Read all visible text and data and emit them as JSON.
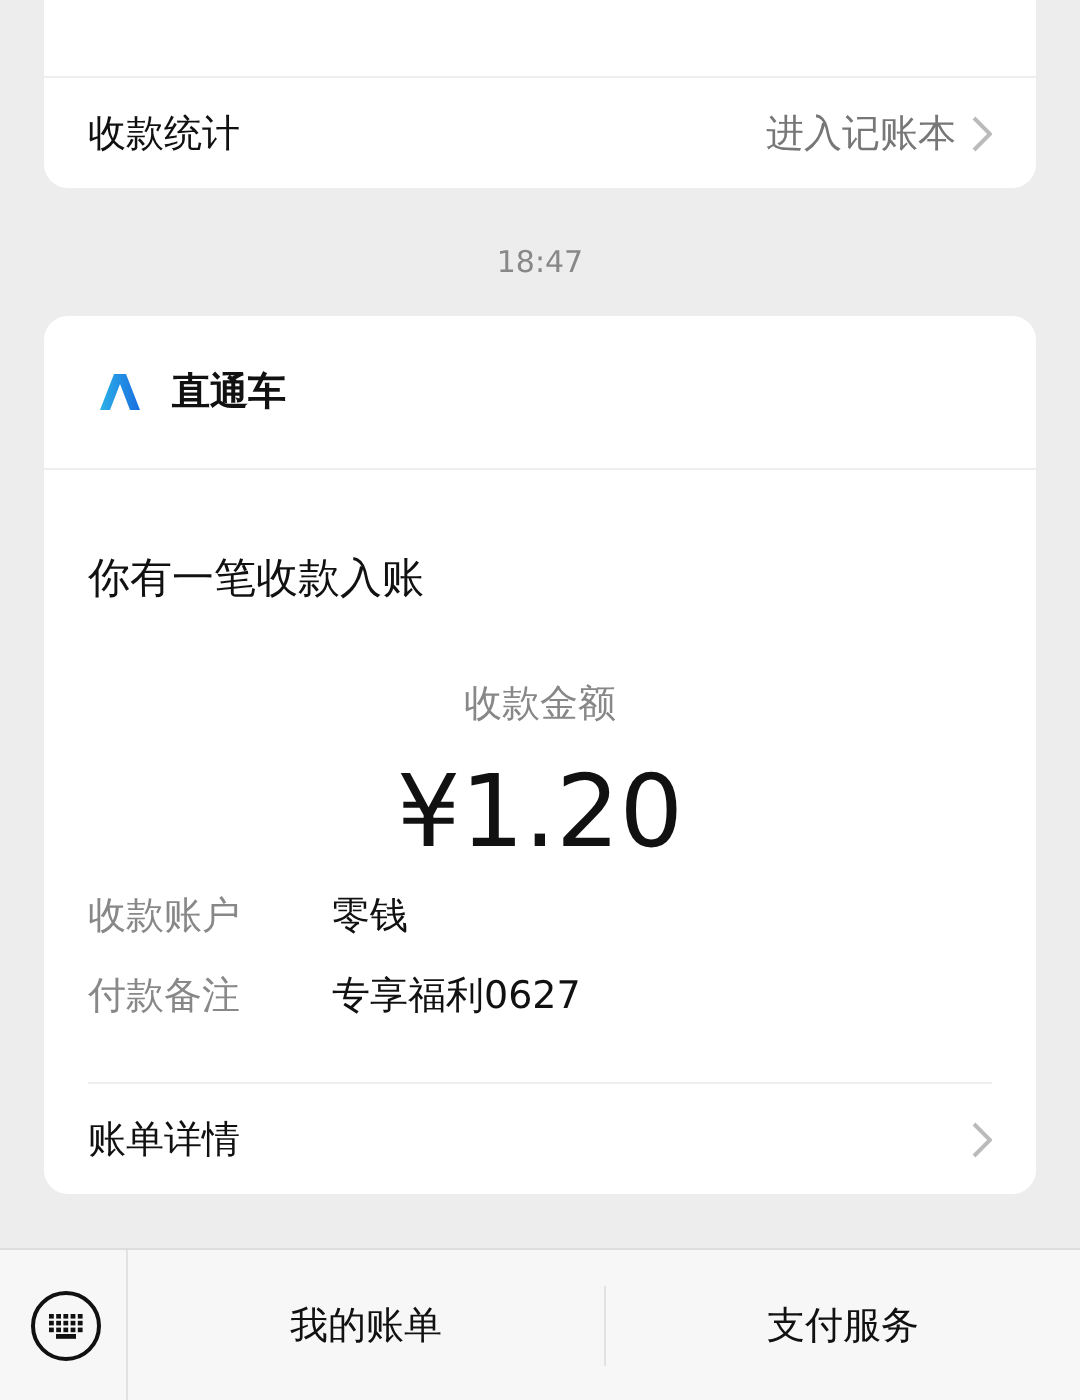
{
  "stats_card": {
    "label": "收款统计",
    "link": "进入记账本"
  },
  "timestamp": "18:47",
  "message_card": {
    "sender": "直通车",
    "headline": "你有一笔收款入账",
    "amount_label": "收款金额",
    "amount": "¥1.20",
    "fields": [
      {
        "label": "收款账户",
        "value": "零钱"
      },
      {
        "label": "付款备注",
        "value": "专享福利0627"
      }
    ],
    "details_link": "账单详情"
  },
  "bottom_bar": {
    "items": [
      "我的账单",
      "支付服务"
    ]
  }
}
